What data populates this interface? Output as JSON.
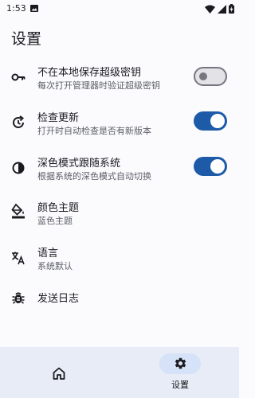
{
  "status_bar": {
    "time": "1:53",
    "icons": [
      "image-icon",
      "wifi-icon",
      "signal-icon",
      "battery-charging-icon"
    ]
  },
  "page": {
    "title": "设置"
  },
  "settings": [
    {
      "icon": "key-icon",
      "title": "不在本地保存超级密钥",
      "subtitle": "每次打开管理器时验证超级密钥",
      "switch_on": false
    },
    {
      "icon": "update-clock-icon",
      "title": "检查更新",
      "subtitle": "打开时自动检查是否有新版本",
      "switch_on": true
    },
    {
      "icon": "contrast-icon",
      "title": "深色模式跟随系统",
      "subtitle": "根据系统的深色模式自动切换",
      "switch_on": true
    },
    {
      "icon": "paint-bucket-icon",
      "title": "颜色主题",
      "subtitle": "蓝色主题"
    },
    {
      "icon": "translate-icon",
      "title": "语言",
      "subtitle": "系统默认"
    },
    {
      "icon": "bug-icon",
      "title": "发送日志"
    }
  ],
  "bottom_nav": {
    "items": [
      {
        "icon": "home-icon",
        "label": "",
        "selected": false
      },
      {
        "icon": "gear-icon",
        "label": "设置",
        "selected": true
      }
    ]
  },
  "colors": {
    "accent": "#1d5ba8",
    "background": "#fbfbfe",
    "nav_background": "#e7ecf6",
    "nav_selected_pill": "#d5e2f7"
  }
}
